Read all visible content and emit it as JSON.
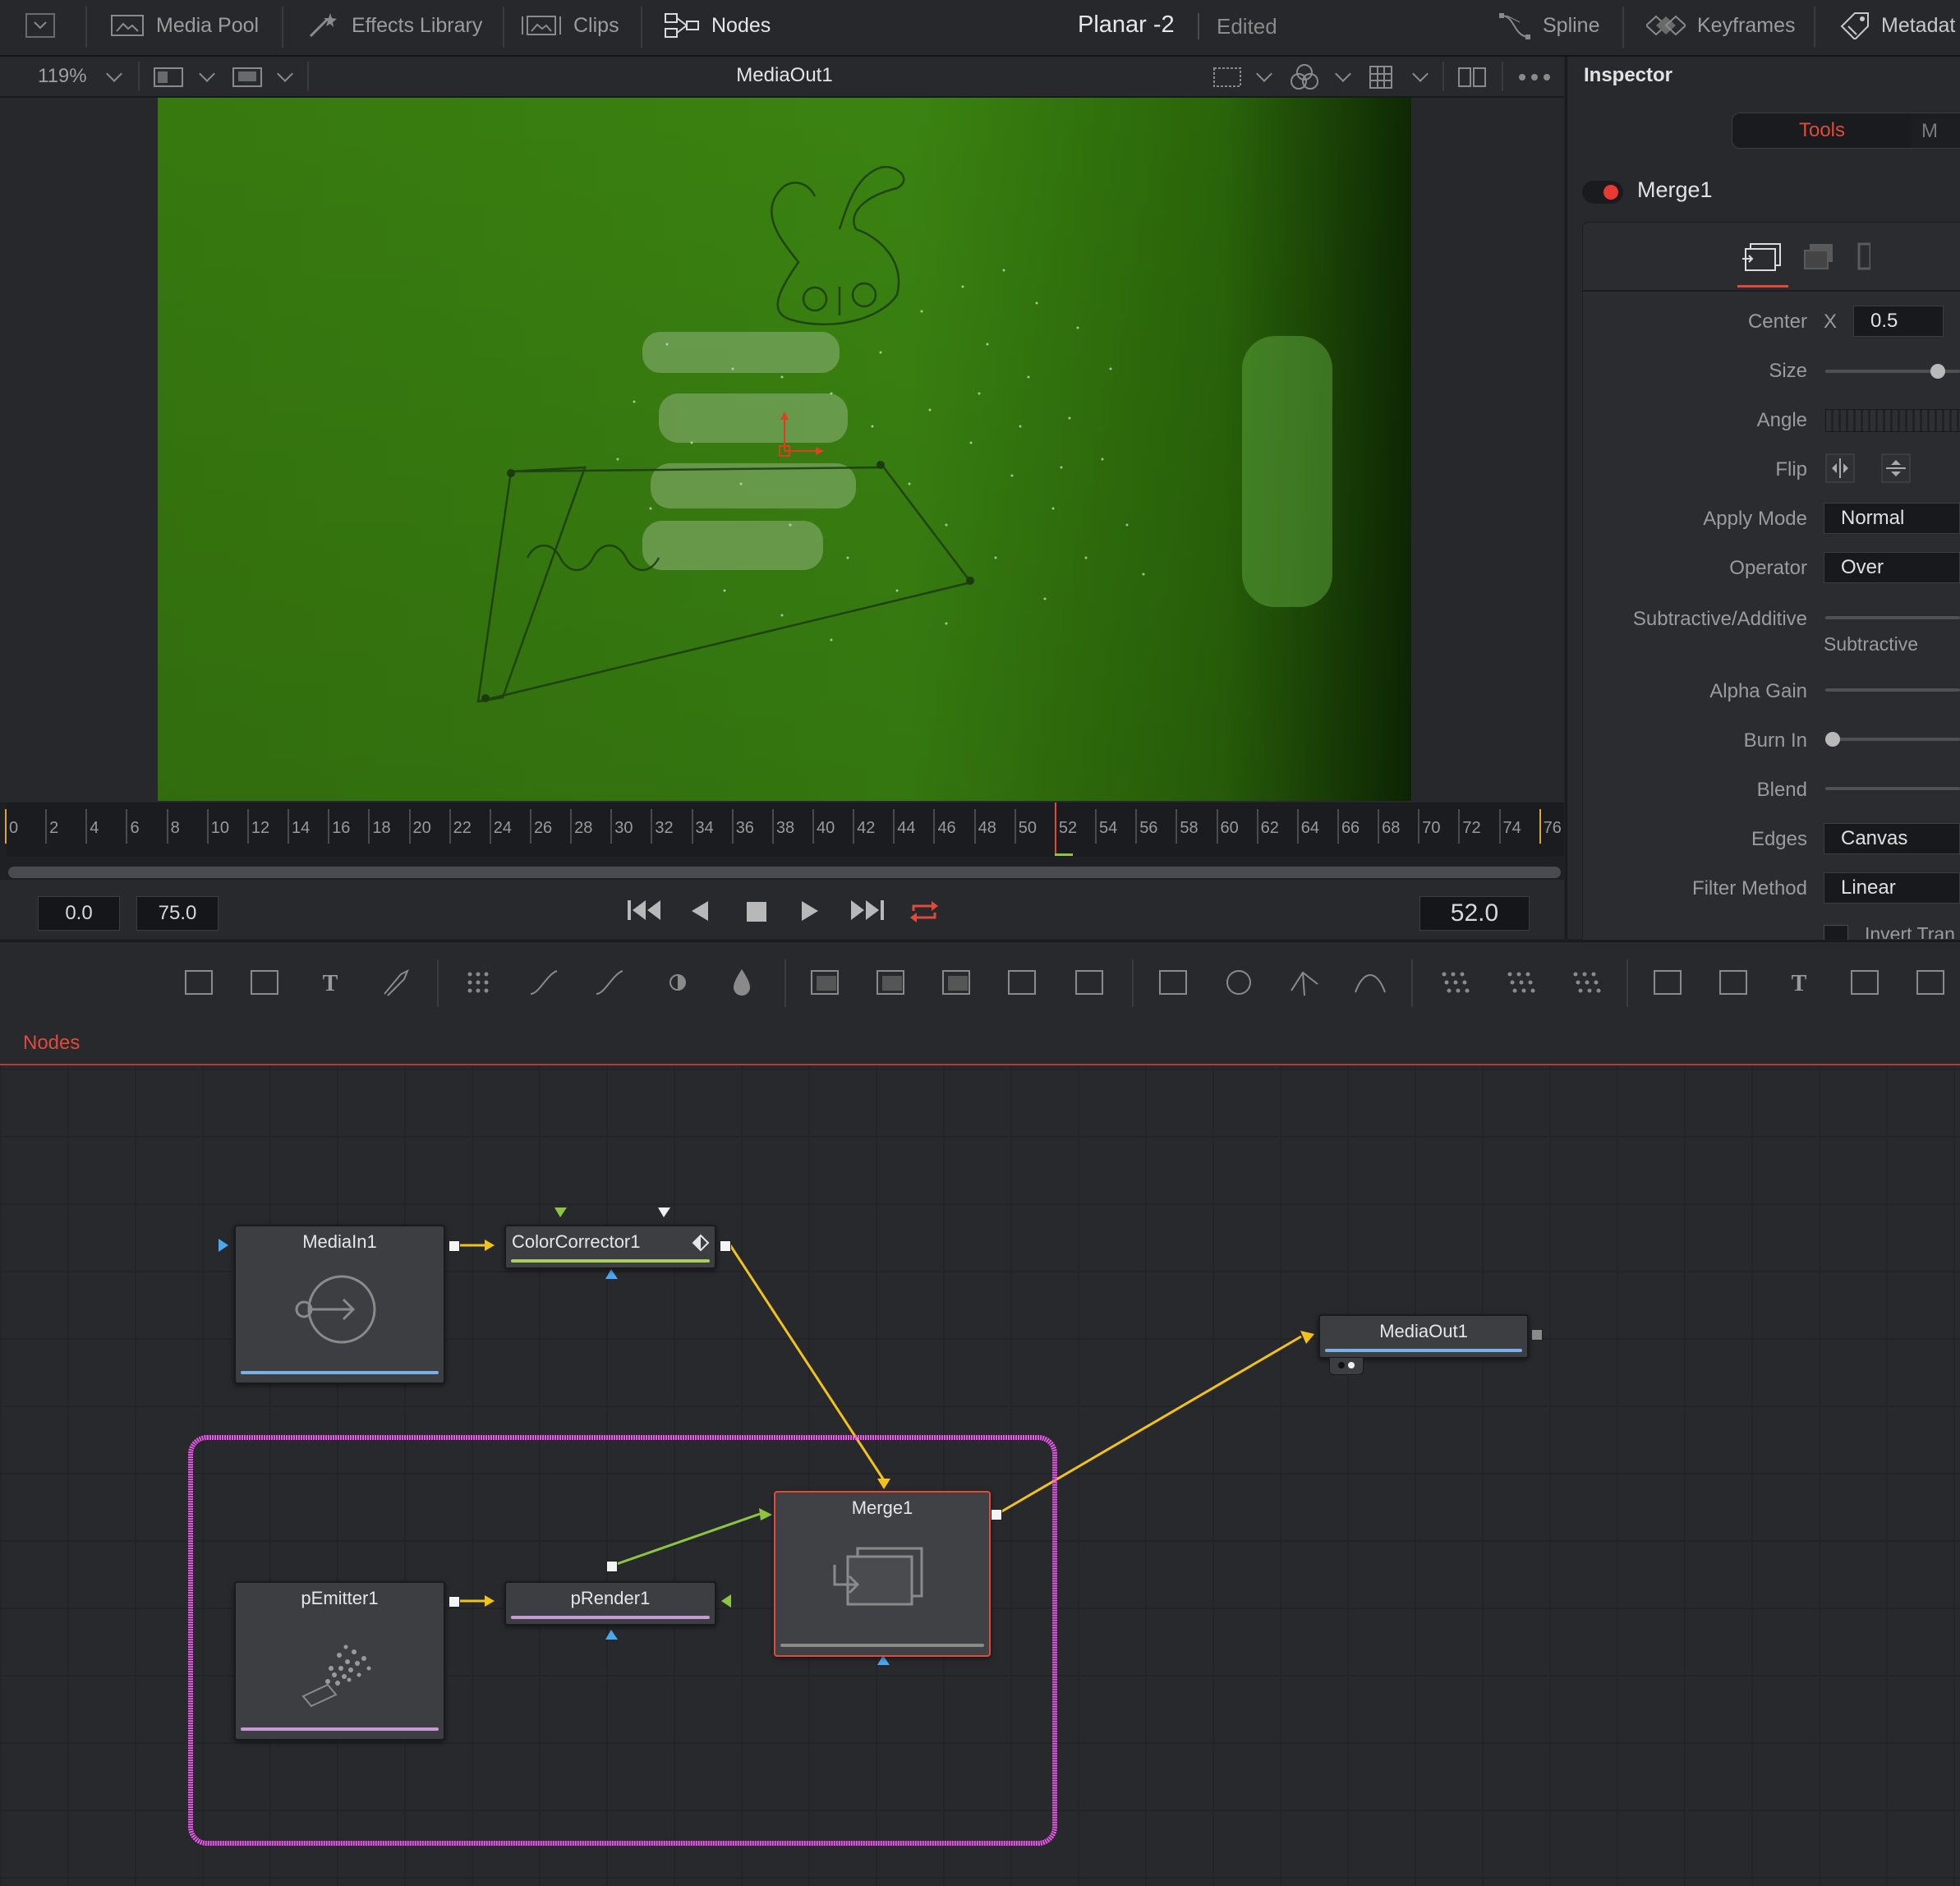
{
  "topbar": {
    "media_pool": "Media Pool",
    "effects_library": "Effects Library",
    "clips": "Clips",
    "nodes": "Nodes",
    "project_title": "Planar -2",
    "project_status": "Edited",
    "spline": "Spline",
    "keyframes": "Keyframes",
    "metadata": "Metadat"
  },
  "viewer": {
    "zoom": "119%",
    "title": "MediaOut1"
  },
  "timeline": {
    "ticks": [
      "0",
      "2",
      "4",
      "6",
      "8",
      "10",
      "12",
      "14",
      "16",
      "18",
      "20",
      "22",
      "24",
      "26",
      "28",
      "30",
      "32",
      "34",
      "36",
      "38",
      "40",
      "42",
      "44",
      "46",
      "48",
      "50",
      "52",
      "54",
      "56",
      "58",
      "60",
      "62",
      "64",
      "66",
      "68",
      "70",
      "72",
      "74",
      "76"
    ],
    "current_frame": 52
  },
  "transport": {
    "start": "0.0",
    "end": "75.0",
    "current": "52.0"
  },
  "inspector": {
    "title": "Inspector",
    "tab_tools": "Tools",
    "tab_other": "M",
    "node_name": "Merge1",
    "labels": {
      "center": "Center",
      "center_x_axis": "X",
      "size": "Size",
      "angle": "Angle",
      "flip": "Flip",
      "apply_mode": "Apply Mode",
      "operator": "Operator",
      "subtractive_additive": "Subtractive/Additive",
      "subtractive": "Subtractive",
      "alpha_gain": "Alpha Gain",
      "burn_in": "Burn In",
      "blend": "Blend",
      "edges": "Edges",
      "filter_method": "Filter Method",
      "invert_transform": "Invert Tran"
    },
    "values": {
      "center_x": "0.5",
      "apply_mode": "Normal",
      "operator": "Over",
      "edges": "Canvas",
      "filter_method": "Linear"
    }
  },
  "nodes_panel": {
    "title": "Nodes",
    "nodes": {
      "media_in": "MediaIn1",
      "color_corrector": "ColorCorrector1",
      "media_out": "MediaOut1",
      "merge": "Merge1",
      "p_emitter": "pEmitter1",
      "p_render": "pRender1"
    }
  },
  "colors": {
    "accent_red": "#e04a3a",
    "connection_yellow": "#f2c21b",
    "connection_green": "#8cc63f",
    "highlight_magenta": "#ee55ee",
    "viewer_green": "#3a8c0e"
  }
}
